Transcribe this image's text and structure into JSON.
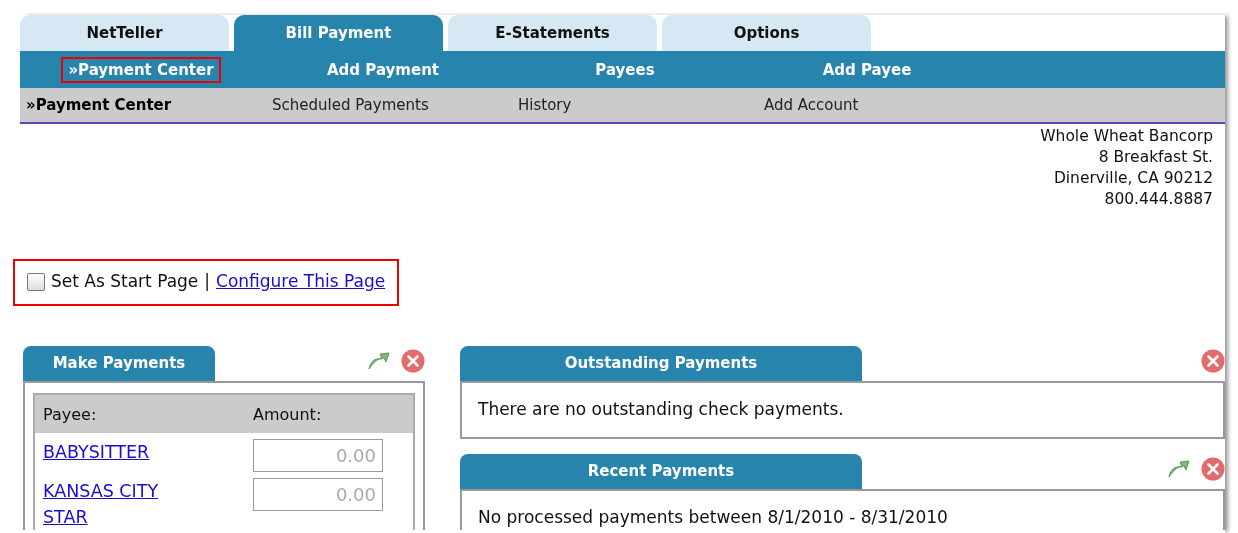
{
  "tabs": [
    {
      "label": "NetTeller",
      "selected": false
    },
    {
      "label": "Bill Payment",
      "selected": true
    },
    {
      "label": "E-Statements",
      "selected": false
    },
    {
      "label": "Options",
      "selected": false
    }
  ],
  "nav": [
    {
      "label": "»Payment Center",
      "highlighted": true
    },
    {
      "label": "Add Payment",
      "highlighted": false
    },
    {
      "label": "Payees",
      "highlighted": false
    },
    {
      "label": "Add Payee",
      "highlighted": false
    }
  ],
  "subnav": [
    {
      "label": "»Payment Center",
      "selected": true
    },
    {
      "label": "Scheduled Payments",
      "selected": false
    },
    {
      "label": "History",
      "selected": false
    },
    {
      "label": "Add Account",
      "selected": false
    }
  ],
  "address": [
    "Whole Wheat Bancorp",
    "8 Breakfast St.",
    "Dinerville, CA 90212",
    "800.444.8887"
  ],
  "start_page": {
    "label": "Set As Start Page",
    "checked": false,
    "separator": "|",
    "link": "Configure This Page",
    "highlighted": true
  },
  "make_payments": {
    "title": "Make Payments",
    "movable": true,
    "closable": true,
    "columns": [
      "Payee:",
      "Amount:"
    ],
    "rows": [
      {
        "payee": "BABYSITTER",
        "placeholder": "0.00"
      },
      {
        "payee": "KANSAS CITY STAR",
        "placeholder": "0.00"
      }
    ]
  },
  "panels": [
    {
      "title": "Outstanding Payments",
      "movable": false,
      "closable": true,
      "message": "There are no outstanding check payments."
    },
    {
      "title": "Recent Payments",
      "movable": true,
      "closable": true,
      "message": "No processed payments between 8/1/2010 - 8/31/2010"
    }
  ]
}
